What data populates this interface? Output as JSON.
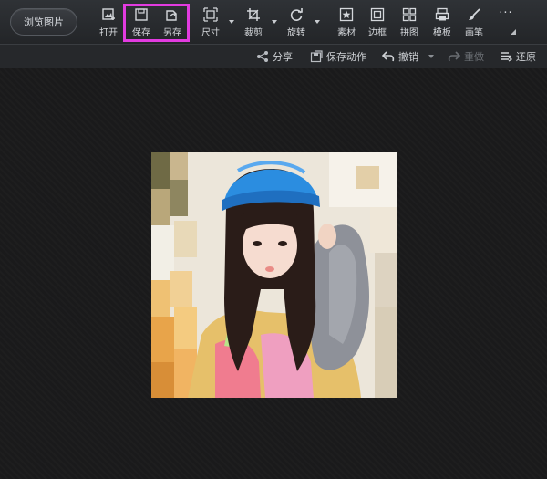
{
  "topbar": {
    "browse_label": "浏览图片",
    "tools": [
      {
        "id": "open",
        "label": "打开",
        "icon": "open-image-icon"
      },
      {
        "id": "save",
        "label": "保存",
        "icon": "save-icon"
      },
      {
        "id": "save_as",
        "label": "另存",
        "icon": "save-as-icon"
      },
      {
        "id": "size",
        "label": "尺寸",
        "icon": "resize-icon"
      },
      {
        "id": "crop",
        "label": "裁剪",
        "icon": "crop-icon"
      },
      {
        "id": "rotate",
        "label": "旋转",
        "icon": "rotate-icon"
      },
      {
        "id": "material",
        "label": "素材",
        "icon": "star-material-icon"
      },
      {
        "id": "border",
        "label": "边框",
        "icon": "frame-icon"
      },
      {
        "id": "collage",
        "label": "拼图",
        "icon": "grid-collage-icon"
      },
      {
        "id": "template",
        "label": "模板",
        "icon": "template-icon"
      },
      {
        "id": "brush",
        "label": "画笔",
        "icon": "brush-icon"
      }
    ],
    "more_symbol": "···",
    "highlight_color": "#e23be0"
  },
  "subbar": {
    "share": "分享",
    "save_action": "保存动作",
    "undo": "撤销",
    "redo": "重做",
    "restore": "还原"
  },
  "colors": {
    "background": "#1b1b1c",
    "toolbar": "#2a2c30",
    "text": "#cfd2d6",
    "disabled_text": "#6a6e73"
  }
}
